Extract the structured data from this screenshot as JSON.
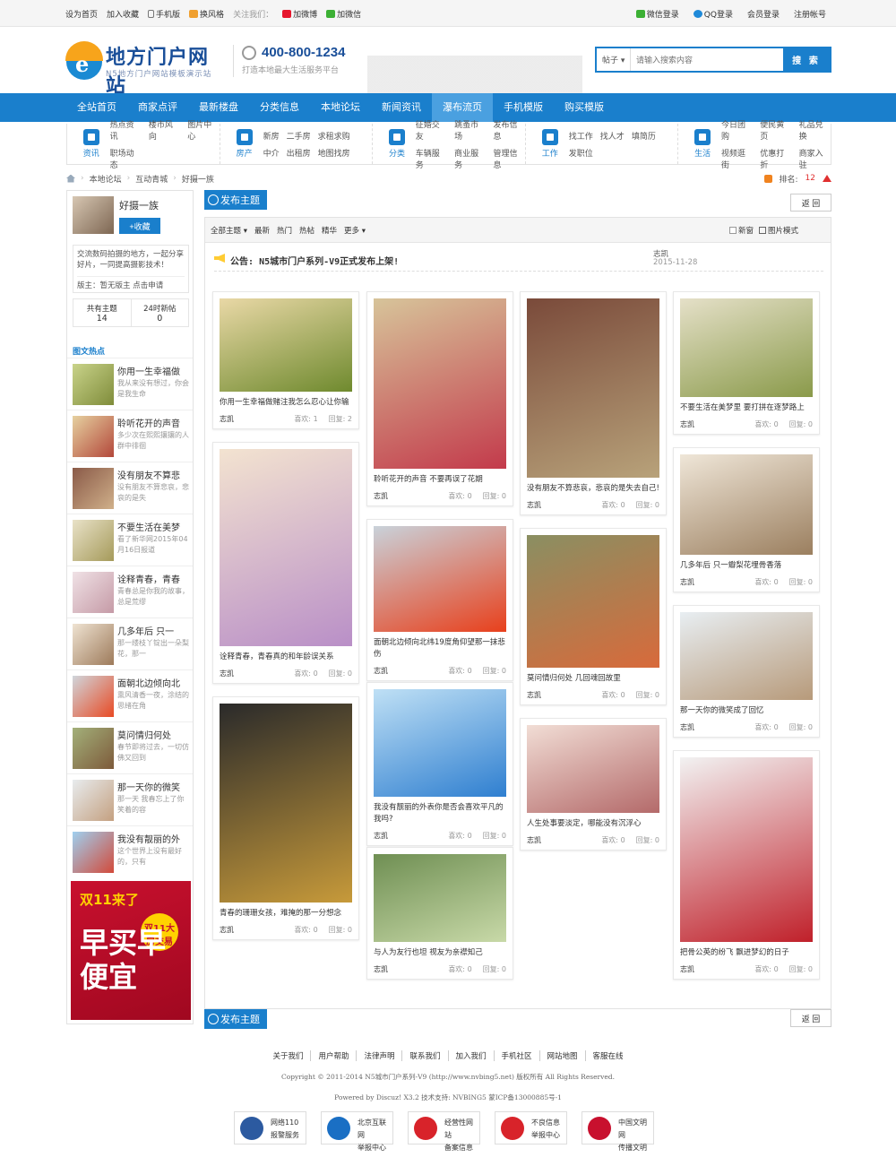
{
  "topbar": {
    "left": [
      "设为首页",
      "加入收藏",
      "手机版",
      "换风格"
    ],
    "follow": "关注我们：",
    "social": [
      "加微博",
      "加微信"
    ],
    "right": [
      "微信登录",
      "QQ登录",
      "会员登录",
      "注册帐号"
    ]
  },
  "header": {
    "logo_title": "地方门户网站",
    "logo_sub": "N5地方门户网站模板演示站",
    "phone": "400-800-1234",
    "slogan": "打造本地最大生活服务平台",
    "search_type": "帖子",
    "search_placeholder": "请输入搜索内容",
    "search_button": "搜 索"
  },
  "nav": [
    "全站首页",
    "商家点评",
    "最新楼盘",
    "分类信息",
    "本地论坛",
    "新闻资讯",
    "瀑布流页",
    "手机模版",
    "购买模版"
  ],
  "nav_active": 6,
  "subnav": [
    {
      "label": "资讯",
      "links": [
        "热点资讯",
        "楼市风向",
        "图片中心",
        "职场动态"
      ]
    },
    {
      "label": "房产",
      "links": [
        "新房",
        "二手房",
        "求租求购",
        "中介",
        "出租房",
        "地图找房"
      ]
    },
    {
      "label": "分类",
      "links": [
        "征婚交友",
        "跳蚤市场",
        "发布信息",
        "车辆服务",
        "商业服务",
        "管理信息"
      ]
    },
    {
      "label": "工作",
      "links": [
        "找工作",
        "找人才",
        "填简历",
        "发职位"
      ]
    },
    {
      "label": "生活",
      "links": [
        "今日团购",
        "便民黄页",
        "礼品兑换",
        "视频逛街",
        "优惠打折",
        "商家入驻"
      ]
    }
  ],
  "breadcrumb": [
    "本地论坛",
    "互动青城",
    "好摄一族"
  ],
  "rank_label": "排名:",
  "rank_value": "12",
  "forum": {
    "name": "好摄一族",
    "fav_button": "+收藏",
    "desc": "交流数码拍摄的地方，一起分享好片，一同提高摄影技术！",
    "moderator": "版主：暂无版主 点击申请",
    "stats": [
      {
        "label": "共有主题",
        "value": "14"
      },
      {
        "label": "24时新帖",
        "value": "0"
      }
    ]
  },
  "hot_title": "图文热点",
  "hot": [
    {
      "t": "你用一生幸福做",
      "d": "我从来没有想过，你会是我生命"
    },
    {
      "t": "聆听花开的声音",
      "d": "多少次在熙熙攘攘的人群中徘徊"
    },
    {
      "t": "没有朋友不算悲",
      "d": "没有朋友不算悲哀，悲哀的是失"
    },
    {
      "t": "不要生活在美梦",
      "d": "看了新华网2015年04月16日报道"
    },
    {
      "t": "诠释青春，青春",
      "d": "青春总是你我的故事，总是荒缪"
    },
    {
      "t": "几多年后 只一",
      "d": "那一缕枝丫锭出一朵梨花，那一"
    },
    {
      "t": "面朝北边倾向北",
      "d": "熏风清香一夜，涂结的思绪在角"
    },
    {
      "t": "莫问情归何处",
      "d": "春节即将过去，一切仿佛又回到"
    },
    {
      "t": "那一天你的微笑",
      "d": "那一天 我春忘上了你笑着的容"
    },
    {
      "t": "我没有靓丽的外",
      "d": "这个世界上没有最好的，只有"
    }
  ],
  "ad": {
    "line1": "双11来了",
    "badge": "双11大房交易",
    "line2": "早买早便宜"
  },
  "post_button": "发布主题",
  "back_button": "返 回",
  "tabs": [
    "全部主题",
    "最新",
    "热门",
    "热帖",
    "精华",
    "更多"
  ],
  "tabs_right": [
    "新窗",
    "图片模式"
  ],
  "notice": {
    "label": "公告:",
    "title": "N5城市门户系列-V9正式发布上架!",
    "author": "志凯",
    "date": "2015-11-28"
  },
  "meta_labels": {
    "likes": "喜欢:",
    "replies": "回复:"
  },
  "cards": [
    {
      "title": "你用一生幸福做赌注我怎么忍心让你输",
      "author": "志凯",
      "likes": "1",
      "replies": "2",
      "col": 0,
      "c1": "#e9d8a6",
      "c2": "#6f8a2e"
    },
    {
      "title": "诠释青春，青春真的和年龄误关系",
      "author": "志凯",
      "likes": "0",
      "replies": "0",
      "col": 0,
      "c1": "#f3e3d0",
      "c2": "#b98fc7"
    },
    {
      "title": "青春的珊珊女孩，难掩的那一分想念",
      "author": "志凯",
      "likes": "0",
      "replies": "0",
      "col": 0,
      "c1": "#2a2a2a",
      "c2": "#c79a3a"
    },
    {
      "title": "聆听花开的声音 不要再误了花期",
      "author": "志凯",
      "likes": "0",
      "replies": "0",
      "col": 1,
      "c1": "#d7c49a",
      "c2": "#c33a4b"
    },
    {
      "title": "面朝北边倾向北纬19度角仰望那一抹悲伤",
      "author": "志凯",
      "likes": "0",
      "replies": "0",
      "col": 1,
      "c1": "#c9d2da",
      "c2": "#e8401c"
    },
    {
      "title": "我没有靓丽的外表你是否会喜欢平凡的我吗?",
      "author": "志凯",
      "likes": "0",
      "replies": "0",
      "col": 1,
      "c1": "#bfe0f5",
      "c2": "#2f7fd0"
    },
    {
      "title": "与人为友行也坦 视友为亲襟知己",
      "author": "志凯",
      "likes": "0",
      "replies": "0",
      "col": 1,
      "c1": "#6f8f53",
      "c2": "#c8d9a8"
    },
    {
      "title": "没有朋友不算悲哀，悲哀的是失去自己!",
      "author": "志凯",
      "likes": "0",
      "replies": "0",
      "col": 2,
      "c1": "#7a4a3a",
      "c2": "#b8a27a"
    },
    {
      "title": "莫问情归何处 几回魂回故里",
      "author": "志凯",
      "likes": "0",
      "replies": "0",
      "col": 2,
      "c1": "#8a8f62",
      "c2": "#d86a3b"
    },
    {
      "title": "人生处事要淡定，哪能没有沉浮心",
      "author": "志凯",
      "likes": "0",
      "replies": "0",
      "col": 2,
      "c1": "#f1ddd5",
      "c2": "#b46a6a"
    },
    {
      "title": "不要生活在美梦里 要打拼在逐梦路上",
      "author": "志凯",
      "likes": "0",
      "replies": "0",
      "col": 3,
      "c1": "#e5e0c8",
      "c2": "#8a9a4a"
    },
    {
      "title": "几多年后 只一瓣梨花埋骨香落",
      "author": "志凯",
      "likes": "0",
      "replies": "0",
      "col": 3,
      "c1": "#efe6d8",
      "c2": "#9b7f5f"
    },
    {
      "title": "那一天你的微笑成了回忆",
      "author": "志凯",
      "likes": "0",
      "replies": "0",
      "col": 3,
      "c1": "#e8eef2",
      "c2": "#b79a7a"
    },
    {
      "title": "把骨公英的纷飞 飘进梦幻的日子",
      "author": "志凯",
      "likes": "0",
      "replies": "0",
      "col": 3,
      "c1": "#f2f2f2",
      "c2": "#c0202a"
    }
  ],
  "footer": {
    "links": [
      "关于我们",
      "用户帮助",
      "法律声明",
      "联系我们",
      "加入我们",
      "手机社区",
      "网站地图",
      "客服在线"
    ],
    "copyright": "Copyright © 2011-2014 N5城市门户系列-V9 (http://www.nvbing5.net) 版权所有 All Rights Reserved.",
    "powered": "Powered by Discuz! X3.2 技术支持: NVBING5 蒙ICP备13000885号-1",
    "badges": [
      {
        "l1": "网络110",
        "l2": "报警服务",
        "color": "#2c5aa0"
      },
      {
        "l1": "北京互联网",
        "l2": "举报中心",
        "color": "#1a6fc4"
      },
      {
        "l1": "经营性网站",
        "l2": "备案信息",
        "color": "#d8232a"
      },
      {
        "l1": "不良信息",
        "l2": "举报中心",
        "color": "#d8232a"
      },
      {
        "l1": "中国文明网",
        "l2": "传播文明",
        "color": "#c8102e"
      }
    ]
  }
}
